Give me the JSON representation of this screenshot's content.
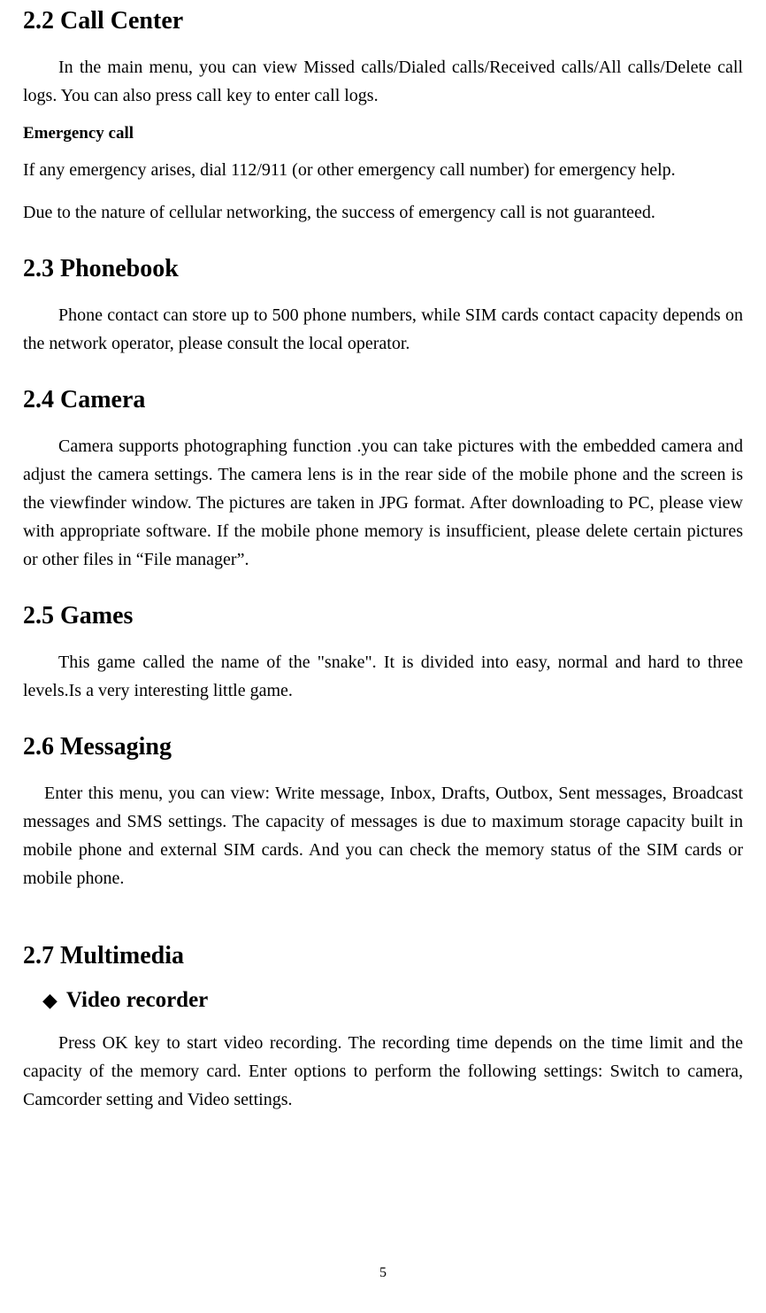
{
  "sections": {
    "callCenter": {
      "heading": "2.2 Call Center",
      "intro": "In the main menu, you can view Missed calls/Dialed calls/Received calls/All calls/Delete call logs. You can also press call key to enter call logs.",
      "emergencyHeading": "Emergency call",
      "emergencyLine1": "If any emergency arises, dial 112/911 (or other emergency call number) for emergency help.",
      "emergencyLine2": "Due to the nature of cellular networking, the success of emergency call is not guaranteed."
    },
    "phonebook": {
      "heading": "2.3 Phonebook",
      "body": "Phone contact can store up to 500 phone numbers, while SIM cards contact capacity depends on the network operator, please consult the local operator."
    },
    "camera": {
      "heading": "2.4 Camera",
      "body": "Camera supports photographing function .you can take pictures with the embedded camera and adjust the camera settings. The camera lens is in the rear side of the mobile phone and the screen is the viewfinder window. The pictures are taken in JPG format. After downloading to PC, please view with appropriate software. If the mobile phone memory is insufficient, please delete certain pictures or other files in “File manager”."
    },
    "games": {
      "heading": "2.5 Games",
      "body": "This game called the name of the \"snake\". It is divided into easy, normal and hard to three levels.Is a very interesting little game."
    },
    "messaging": {
      "heading": "2.6 Messaging",
      "body": "Enter this menu, you can view: Write message, Inbox, Drafts, Outbox, Sent messages, Broadcast messages and SMS settings. The capacity of messages is due to maximum storage capacity built in mobile phone and external SIM cards. And you can check the memory status of the SIM cards or mobile phone."
    },
    "multimedia": {
      "heading": "2.7 Multimedia",
      "videoRecorder": {
        "bulletLabel": "Video recorder",
        "body": "Press OK key to start video recording. The recording time depends on the time limit and the capacity of the memory card. Enter options to perform the following settings: Switch to camera, Camcorder setting and Video settings."
      }
    }
  },
  "icons": {
    "diamond": "◆"
  },
  "pageNumber": "5"
}
